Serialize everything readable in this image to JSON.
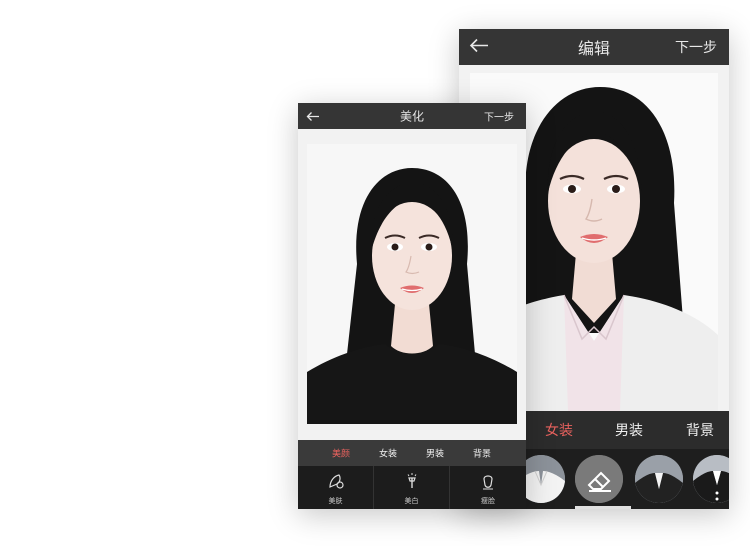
{
  "editor_screen": {
    "title": "编辑",
    "next_label": "下一步",
    "tabs": [
      "女装",
      "男装",
      "背景"
    ],
    "active_tab": "女装",
    "swatches": [
      "white-shirt-outfit",
      "eraser-icon",
      "white-shirt-black-jacket",
      "black-suit-white-shirt"
    ]
  },
  "beautify_screen": {
    "title": "美化",
    "next_label": "下一步",
    "tabs": [
      "美颜",
      "女装",
      "男装",
      "背景"
    ],
    "active_tab": "美颜",
    "tools": [
      "美肤",
      "美白",
      "瘦脸"
    ]
  },
  "colors": {
    "accent": "#e8625e",
    "topbar": "#353535",
    "panel": "#1e1e1e"
  }
}
